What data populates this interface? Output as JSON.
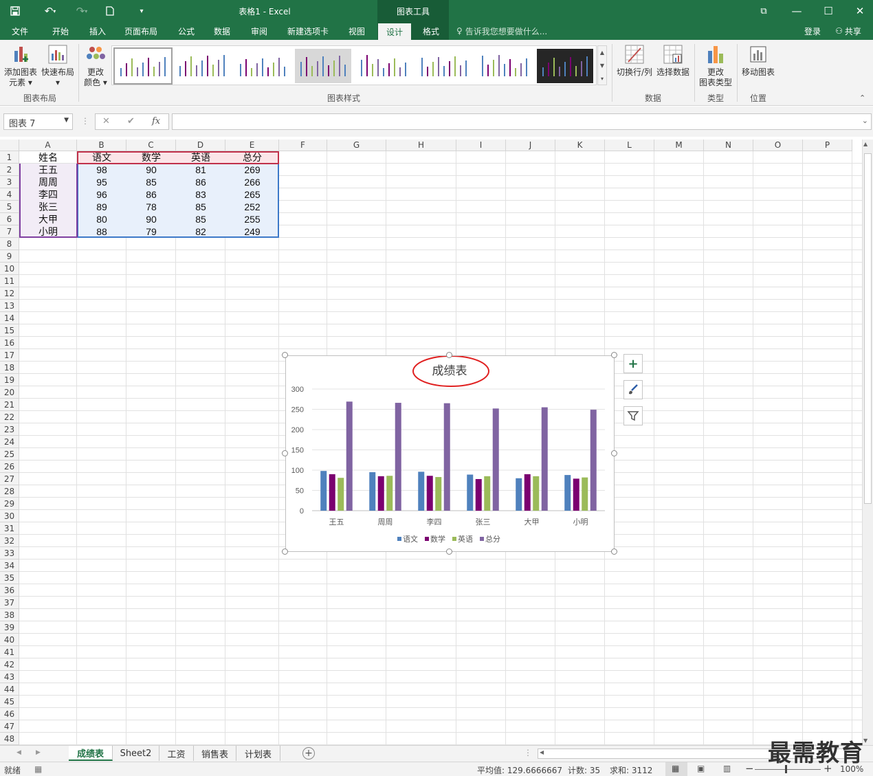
{
  "window": {
    "title": "表格1 - Excel",
    "context_tab_group": "图表工具"
  },
  "menu": {
    "tabs": [
      "文件",
      "开始",
      "插入",
      "页面布局",
      "公式",
      "数据",
      "审阅",
      "新建选项卡",
      "视图",
      "设计",
      "格式"
    ],
    "active_tab": "设计",
    "tell_me": "告诉我您想要做什么...",
    "login": "登录",
    "share": "共享"
  },
  "ribbon": {
    "add_element": [
      "添加图表",
      "元素"
    ],
    "quick_layout": "快速布局",
    "change_color": [
      "更改",
      "颜色"
    ],
    "group_layout": "图表布局",
    "group_styles": "图表样式",
    "switch_row_col": "切换行/列",
    "select_data": "选择数据",
    "group_data": "数据",
    "change_type": [
      "更改",
      "图表类型"
    ],
    "group_type": "类型",
    "move_chart": "移动图表",
    "group_location": "位置"
  },
  "formula_bar": {
    "name_box": "图表 7",
    "fx": "fx",
    "value": ""
  },
  "columns": [
    "A",
    "B",
    "C",
    "D",
    "E",
    "F",
    "G",
    "H",
    "I",
    "J",
    "K",
    "L",
    "M",
    "N",
    "O",
    "P"
  ],
  "rows": [
    "1",
    "2",
    "3",
    "4",
    "5",
    "6",
    "7",
    "8",
    "9",
    "10",
    "11",
    "12",
    "13",
    "14",
    "15",
    "16",
    "17",
    "18",
    "19",
    "20",
    "21",
    "22",
    "23",
    "24",
    "25",
    "26",
    "27",
    "28",
    "29",
    "30",
    "31",
    "32",
    "33",
    "34",
    "35",
    "36",
    "37",
    "38",
    "39",
    "40",
    "41",
    "42",
    "43",
    "44",
    "45",
    "46",
    "47",
    "48"
  ],
  "table": {
    "headers": [
      "姓名",
      "语文",
      "数学",
      "英语",
      "总分"
    ],
    "rows": [
      [
        "王五",
        "98",
        "90",
        "81",
        "269"
      ],
      [
        "周周",
        "95",
        "85",
        "86",
        "266"
      ],
      [
        "李四",
        "96",
        "86",
        "83",
        "265"
      ],
      [
        "张三",
        "89",
        "78",
        "85",
        "252"
      ],
      [
        "大甲",
        "80",
        "90",
        "85",
        "255"
      ],
      [
        "小明",
        "88",
        "79",
        "82",
        "249"
      ]
    ]
  },
  "chart_data": {
    "type": "bar",
    "title": "成绩表",
    "categories": [
      "王五",
      "周周",
      "李四",
      "张三",
      "大甲",
      "小明"
    ],
    "series": [
      {
        "name": "语文",
        "values": [
          98,
          95,
          96,
          89,
          80,
          88
        ],
        "color": "#4f81bd"
      },
      {
        "name": "数学",
        "values": [
          90,
          85,
          86,
          78,
          90,
          79
        ],
        "color": "#7b0070"
      },
      {
        "name": "英语",
        "values": [
          81,
          86,
          83,
          85,
          85,
          82
        ],
        "color": "#9bbb59"
      },
      {
        "name": "总分",
        "values": [
          269,
          266,
          265,
          252,
          255,
          249
        ],
        "color": "#8064a2"
      }
    ],
    "yticks": [
      "0",
      "50",
      "100",
      "150",
      "200",
      "250",
      "300"
    ],
    "ylim": [
      0,
      300
    ],
    "grid": true,
    "legend_position": "bottom",
    "annotation_color": "#e02020"
  },
  "sheets": {
    "tabs": [
      "成绩表",
      "Sheet2",
      "工资",
      "销售表",
      "计划表"
    ],
    "active": "成绩表"
  },
  "status": {
    "ready": "就绪",
    "average": "平均值: 129.6666667",
    "count": "计数: 35",
    "sum": "求和: 3112",
    "zoom": "100%"
  },
  "watermark": "最需教育"
}
